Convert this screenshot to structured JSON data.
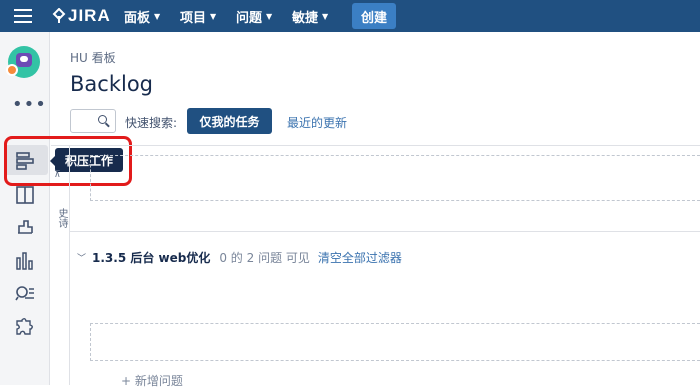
{
  "topbar": {
    "logo_text": "JIRA",
    "menus": [
      {
        "label": "面板"
      },
      {
        "label": "项目"
      },
      {
        "label": "问题"
      },
      {
        "label": "敏捷"
      }
    ],
    "create_label": "创建",
    "bg_color": "#205081",
    "create_color": "#3b7fc4"
  },
  "sidebar": {
    "more_label": "•••",
    "items": [
      {
        "icon": "backlog-icon",
        "active": true
      },
      {
        "icon": "board-icon"
      },
      {
        "icon": "releases-icon"
      },
      {
        "icon": "reports-icon"
      },
      {
        "icon": "issues-search-icon"
      },
      {
        "icon": "addons-icon"
      }
    ],
    "tooltip": "积压工作"
  },
  "main": {
    "breadcrumb": "HU 看板",
    "title": "Backlog",
    "quick_search_label": "快速搜索:",
    "filter_active": "仅我的任务",
    "filter_link": "最近的更新",
    "epics_label": "史诗",
    "sprint": {
      "name": "1.3.5 后台 web优化",
      "count_text": "0 的 2 问题 可见",
      "clear_filters": "清空全部过滤器"
    },
    "add_issue": "+ 新增问题"
  }
}
